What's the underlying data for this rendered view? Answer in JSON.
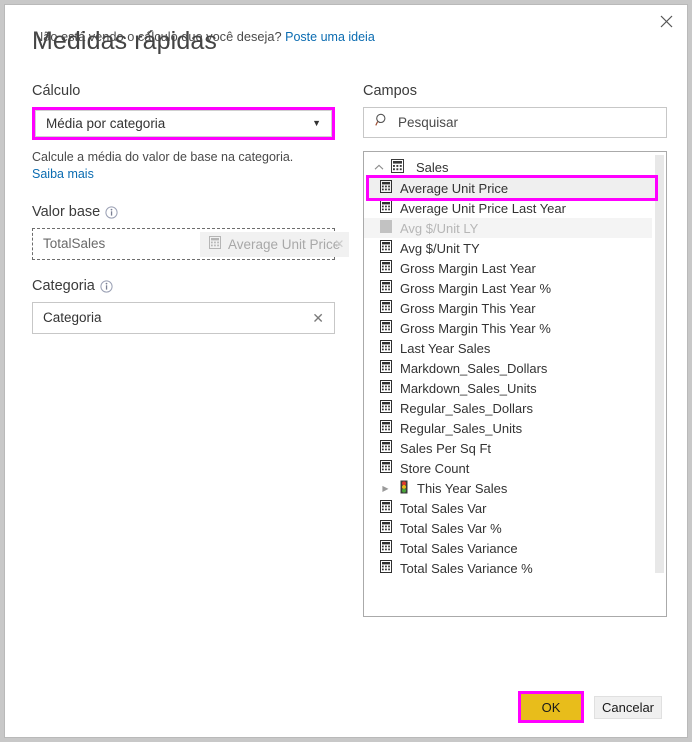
{
  "dialog": {
    "title": "Medidas rápidas",
    "close_icon": "close-icon"
  },
  "calculation": {
    "label": "Cálculo",
    "selected": "Média por categoria",
    "caret": "▼",
    "description": "Calcule a média do valor de base na categoria.",
    "learn_more": "Saiba mais"
  },
  "base_value": {
    "label": "Valor base",
    "info_icon": "info-icon",
    "value": "TotalSales",
    "drag_ghost": {
      "text": "Average Unit Price",
      "icon": "measure-icon",
      "close": "✕"
    }
  },
  "category": {
    "label": "Categoria",
    "info_icon": "info-icon",
    "value": "Categoria",
    "clear": "✕"
  },
  "fields": {
    "label": "Campos",
    "search": {
      "placeholder": "Pesquisar",
      "value": "",
      "icon": "search-icon"
    },
    "table": {
      "name": "Sales",
      "icon": "table-icon",
      "collapse_icon": "chevron-up-icon"
    },
    "items": [
      {
        "label": "Average Unit Price",
        "icon": "measure-icon",
        "state": "selected"
      },
      {
        "label": "Average Unit Price Last Year",
        "icon": "measure-icon",
        "state": "normal"
      },
      {
        "label": "Avg $/Unit LY",
        "icon": "measure-icon",
        "state": "dragging"
      },
      {
        "label": "Avg $/Unit TY",
        "icon": "measure-icon",
        "state": "normal"
      },
      {
        "label": "Gross Margin Last Year",
        "icon": "measure-icon",
        "state": "normal"
      },
      {
        "label": "Gross Margin Last Year %",
        "icon": "measure-icon",
        "state": "normal"
      },
      {
        "label": "Gross Margin This Year",
        "icon": "measure-icon",
        "state": "normal"
      },
      {
        "label": "Gross Margin This Year %",
        "icon": "measure-icon",
        "state": "normal"
      },
      {
        "label": "Last Year Sales",
        "icon": "measure-icon",
        "state": "normal"
      },
      {
        "label": "Markdown_Sales_Dollars",
        "icon": "measure-icon",
        "state": "normal"
      },
      {
        "label": "Markdown_Sales_Units",
        "icon": "measure-icon",
        "state": "normal"
      },
      {
        "label": "Regular_Sales_Dollars",
        "icon": "measure-icon",
        "state": "normal"
      },
      {
        "label": "Regular_Sales_Units",
        "icon": "measure-icon",
        "state": "normal"
      },
      {
        "label": "Sales Per Sq Ft",
        "icon": "measure-icon",
        "state": "normal"
      },
      {
        "label": "Store Count",
        "icon": "measure-icon",
        "state": "normal"
      },
      {
        "label": "This Year Sales",
        "icon": "kpi-icon",
        "state": "expandable",
        "expand_icon": "chevron-right-icon"
      },
      {
        "label": "Total Sales Var",
        "icon": "measure-icon",
        "state": "normal"
      },
      {
        "label": "Total Sales Var %",
        "icon": "measure-icon",
        "state": "normal"
      },
      {
        "label": "Total Sales Variance",
        "icon": "measure-icon",
        "state": "normal"
      },
      {
        "label": "Total Sales Variance %",
        "icon": "measure-icon",
        "state": "normal"
      }
    ]
  },
  "footer": {
    "prompt": "Não está vendo o cálculo que você deseja?",
    "idea_link": "Poste uma ideia",
    "ok": "OK",
    "cancel": "Cancelar"
  },
  "colors": {
    "highlight": "#ff00ff",
    "ok_button": "#e8bd1b",
    "link": "#0b6cb1"
  }
}
